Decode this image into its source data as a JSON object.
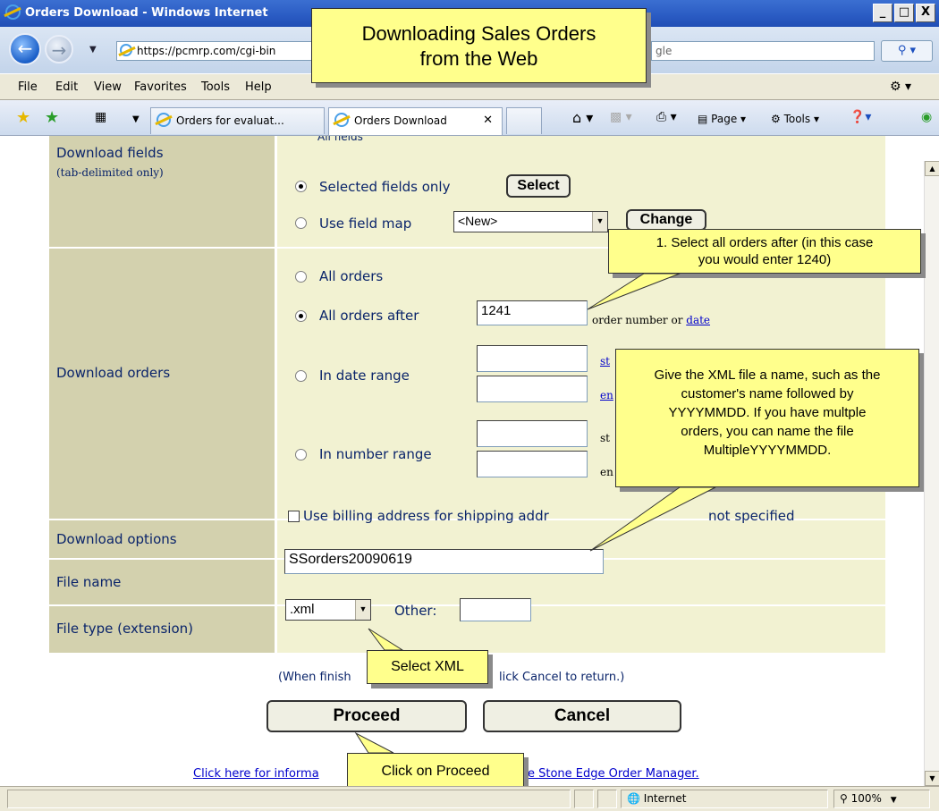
{
  "window": {
    "title": "Orders Download - Windows Internet",
    "min": "_",
    "max": "□",
    "close": "X"
  },
  "address": {
    "url": "https://pcmrp.com/cgi-bin",
    "search_text": "gle"
  },
  "menu": [
    "File",
    "Edit",
    "View",
    "Favorites",
    "Tools",
    "Help"
  ],
  "tabs": [
    {
      "label": "Orders for evaluat..."
    },
    {
      "label": "Orders Download"
    }
  ],
  "toolbar": {
    "page": "Page",
    "tools": "Tools"
  },
  "form": {
    "download_fields": {
      "label": "Download fields",
      "sub": "(tab-delimited only)",
      "selected_only": "Selected fields only",
      "select_btn": "Select",
      "use_map": "Use field map",
      "map_value": "<New>",
      "change_btn": "Change"
    },
    "download_orders": {
      "label": "Download orders",
      "all": "All orders",
      "after": "All orders after",
      "after_value": "1241",
      "after_hint": "order number or",
      "after_link": "date",
      "date_range": "In date range",
      "number_range": "In number range",
      "st1": "st",
      "en1": "en",
      "st2": "st",
      "en2": "en"
    },
    "download_options": {
      "label": "Download options",
      "billing": "Use billing address for shipping addr",
      "billing_tail": "not specified"
    },
    "file_name": {
      "label": "File name",
      "value": "SSorders20090619"
    },
    "file_type": {
      "label": "File type (extension)",
      "value": ".xml",
      "other": "Other:"
    }
  },
  "instructions": {
    "left": "(When finish",
    "right": "lick Cancel to return.)"
  },
  "buttons": {
    "proceed": "Proceed",
    "cancel": "Cancel"
  },
  "footer_link": {
    "left": "Click here for informa",
    "right": "e Stone Edge Order Manager."
  },
  "callouts": {
    "title_line1": "Downloading Sales Orders",
    "title_line2": "from the Web",
    "after_line1": "1. Select all orders after (in this case",
    "after_line2": "you would enter 1240)",
    "file_line1": "Give the XML file a name, such as the",
    "file_line2": "customer's name followed by",
    "file_line3": "YYYYMMDD.  If you have multple",
    "file_line4": "orders, you can name the file",
    "file_line5": "MultipleYYYYMMDD.",
    "xml": "Select XML",
    "proceed": "Click on Proceed"
  },
  "status": {
    "zone": "Internet",
    "zoom": "100%"
  }
}
